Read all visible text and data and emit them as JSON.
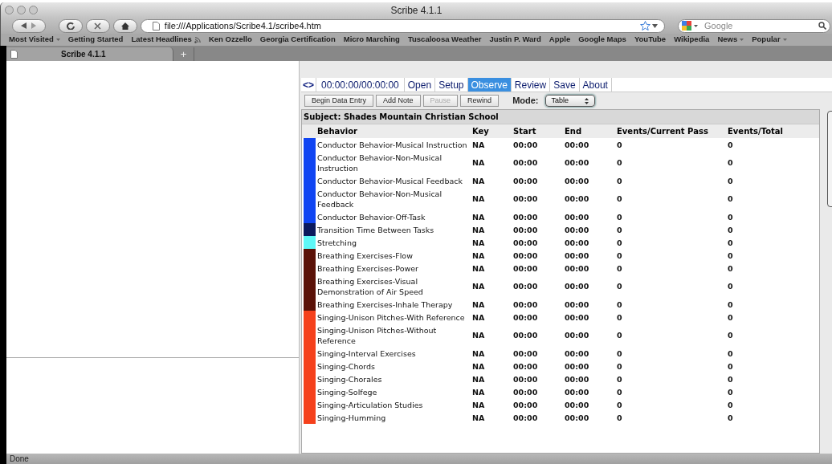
{
  "window": {
    "title": "Scribe 4.1.1"
  },
  "toolbar": {
    "url": "file:///Applications/Scribe4.1/scribe4.htm",
    "search": {
      "placeholder": "Google"
    }
  },
  "bookmarks": [
    {
      "label": "Most Visited",
      "kind": "menu"
    },
    {
      "label": "Getting Started",
      "kind": "plain"
    },
    {
      "label": "Latest Headlines",
      "kind": "feed"
    },
    {
      "label": "Ken Ozzello",
      "kind": "plain"
    },
    {
      "label": "Georgia Certification",
      "kind": "plain"
    },
    {
      "label": "Micro Marching",
      "kind": "plain"
    },
    {
      "label": "Tuscaloosa Weather",
      "kind": "plain"
    },
    {
      "label": "Justin P. Ward",
      "kind": "plain"
    },
    {
      "label": "Apple",
      "kind": "plain"
    },
    {
      "label": "Google Maps",
      "kind": "plain"
    },
    {
      "label": "YouTube",
      "kind": "plain"
    },
    {
      "label": "Wikipedia",
      "kind": "plain"
    },
    {
      "label": "News",
      "kind": "menu"
    },
    {
      "label": "Popular",
      "kind": "menu"
    }
  ],
  "browser_tabs": [
    {
      "label": "Scribe 4.1.1",
      "selected": true
    }
  ],
  "new_tab": "+",
  "app": {
    "toggle": "<>",
    "timer": "00:00:00/00:00:00",
    "tabs": [
      {
        "label": "Open",
        "selected": false
      },
      {
        "label": "Setup",
        "selected": false
      },
      {
        "label": "Observe",
        "selected": true
      },
      {
        "label": "Review",
        "selected": false
      },
      {
        "label": "Save",
        "selected": false
      },
      {
        "label": "About",
        "selected": false
      }
    ],
    "buttons": [
      {
        "label": "Begin Data Entry",
        "disabled": false
      },
      {
        "label": "Add Note",
        "disabled": false
      },
      {
        "label": "Pause",
        "disabled": true
      },
      {
        "label": "Rewind",
        "disabled": false
      }
    ],
    "mode": {
      "label": "Mode:",
      "value": "Table"
    },
    "subject": "Subject: Shades Mountain Christian School",
    "table": {
      "columns": [
        "Behavior",
        "Key",
        "Start",
        "End",
        "Events/Current Pass",
        "Events/Total"
      ],
      "rows": [
        {
          "color": "#1045f2",
          "cells": [
            "Conductor Behavior-Musical Instruction",
            "NA",
            "00:00",
            "00:00",
            "0",
            "0"
          ]
        },
        {
          "color": "#1045f2",
          "cells": [
            "Conductor Behavior-Non-Musical Instruction",
            "NA",
            "00:00",
            "00:00",
            "0",
            "0"
          ]
        },
        {
          "color": "#1045f2",
          "cells": [
            "Conductor Behavior-Musical Feedback",
            "NA",
            "00:00",
            "00:00",
            "0",
            "0"
          ]
        },
        {
          "color": "#1045f2",
          "cells": [
            "Conductor Behavior-Non-Musical Feedback",
            "NA",
            "00:00",
            "00:00",
            "0",
            "0"
          ]
        },
        {
          "color": "#1045f2",
          "cells": [
            "Conductor Behavior-Off-Task",
            "NA",
            "00:00",
            "00:00",
            "0",
            "0"
          ]
        },
        {
          "color": "#0b1a5e",
          "cells": [
            "Transition Time Between Tasks",
            "NA",
            "00:00",
            "00:00",
            "0",
            "0"
          ]
        },
        {
          "color": "#5ef7f7",
          "cells": [
            "Stretching",
            "NA",
            "00:00",
            "00:00",
            "0",
            "0"
          ]
        },
        {
          "color": "#5a1208",
          "cells": [
            "Breathing Exercises-Flow",
            "NA",
            "00:00",
            "00:00",
            "0",
            "0"
          ]
        },
        {
          "color": "#5a1208",
          "cells": [
            "Breathing Exercises-Power",
            "NA",
            "00:00",
            "00:00",
            "0",
            "0"
          ]
        },
        {
          "color": "#5a1208",
          "cells": [
            "Breathing Exercises-Visual Demonstration of Air Speed",
            "NA",
            "00:00",
            "00:00",
            "0",
            "0"
          ]
        },
        {
          "color": "#5a1208",
          "cells": [
            "Breathing Exercises-Inhale Therapy",
            "NA",
            "00:00",
            "00:00",
            "0",
            "0"
          ]
        },
        {
          "color": "#f5411c",
          "cells": [
            "Singing-Unison Pitches-With Reference",
            "NA",
            "00:00",
            "00:00",
            "0",
            "0"
          ]
        },
        {
          "color": "#f5411c",
          "cells": [
            "Singing-Unison Pitches-Without Reference",
            "NA",
            "00:00",
            "00:00",
            "0",
            "0"
          ]
        },
        {
          "color": "#f5411c",
          "cells": [
            "Singing-Interval Exercises",
            "NA",
            "00:00",
            "00:00",
            "0",
            "0"
          ]
        },
        {
          "color": "#f5411c",
          "cells": [
            "Singing-Chords",
            "NA",
            "00:00",
            "00:00",
            "0",
            "0"
          ]
        },
        {
          "color": "#f5411c",
          "cells": [
            "Singing-Chorales",
            "NA",
            "00:00",
            "00:00",
            "0",
            "0"
          ]
        },
        {
          "color": "#f5411c",
          "cells": [
            "Singing-Solfege",
            "NA",
            "00:00",
            "00:00",
            "0",
            "0"
          ]
        },
        {
          "color": "#f5411c",
          "cells": [
            "Singing-Articulation Studies",
            "NA",
            "00:00",
            "00:00",
            "0",
            "0"
          ]
        },
        {
          "color": "#f5411c",
          "cells": [
            "Singing-Humming",
            "NA",
            "00:00",
            "00:00",
            "0",
            "0"
          ]
        }
      ]
    }
  },
  "status_bar": "Done"
}
